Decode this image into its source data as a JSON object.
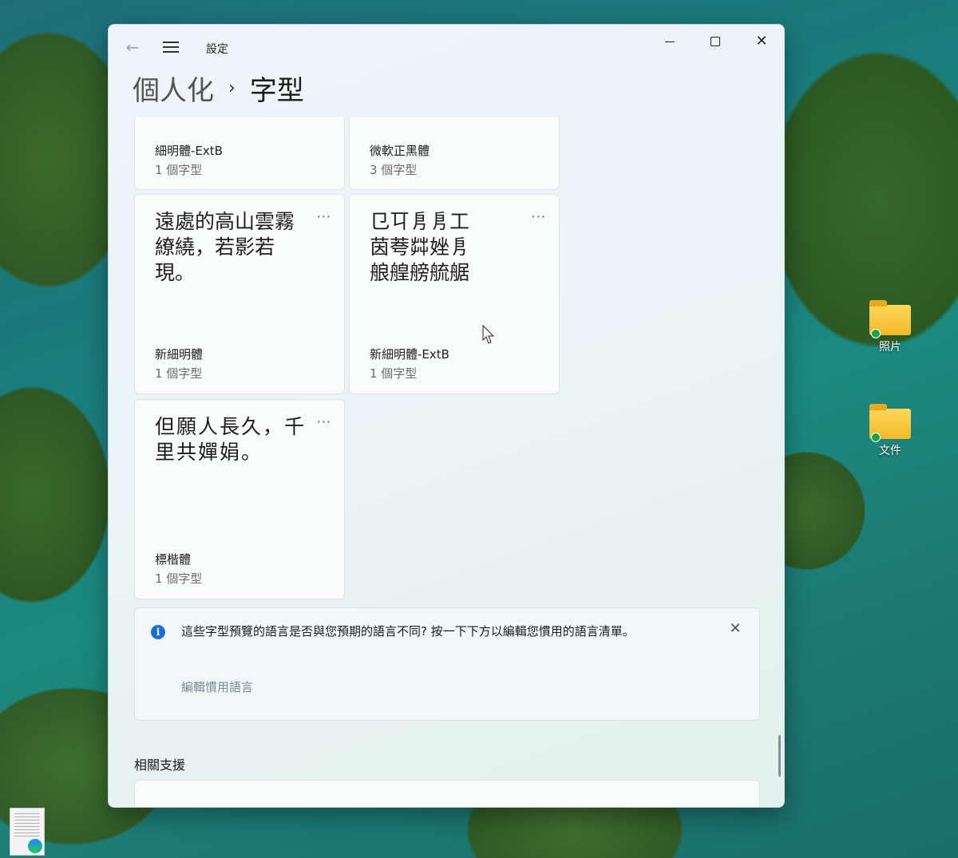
{
  "desktop": {
    "icons": [
      {
        "label": "照片"
      },
      {
        "label": "文件"
      }
    ]
  },
  "window": {
    "app_title": "設定",
    "controls": {
      "minimize": "—",
      "maximize": "□",
      "close": "✕"
    },
    "breadcrumb": {
      "parent": "個人化",
      "separator": "›",
      "current": "字型"
    }
  },
  "font_cards": [
    {
      "preview": "",
      "name": "細明體-ExtB",
      "count": "1 個字型",
      "more": "···"
    },
    {
      "preview": "",
      "name": "微軟正黑體",
      "count": "3 個字型",
      "more": "···"
    },
    {
      "preview": "遠處的高山雲霧繚繞，若影若現。",
      "name": "新細明體",
      "count": "1 個字型",
      "more": "···"
    },
    {
      "preview": "㔾㔿㐆㐆工\n茵荂茻㛗㐆\n艆艎艕艈艍",
      "name": "新細明體-ExtB",
      "count": "1 個字型",
      "more": "···"
    },
    {
      "preview": "但願人長久，千里共嬋娟。",
      "name": "標楷體",
      "count": "1 個字型",
      "more": "···"
    }
  ],
  "info_bar": {
    "icon": "i",
    "message": "這些字型預覽的語言是否與您預期的語言不同? 按一下下方以編輯您慣用的語言清單。",
    "link": "編輯慣用語言",
    "close": "✕"
  },
  "related_support": {
    "title": "相關支援"
  }
}
